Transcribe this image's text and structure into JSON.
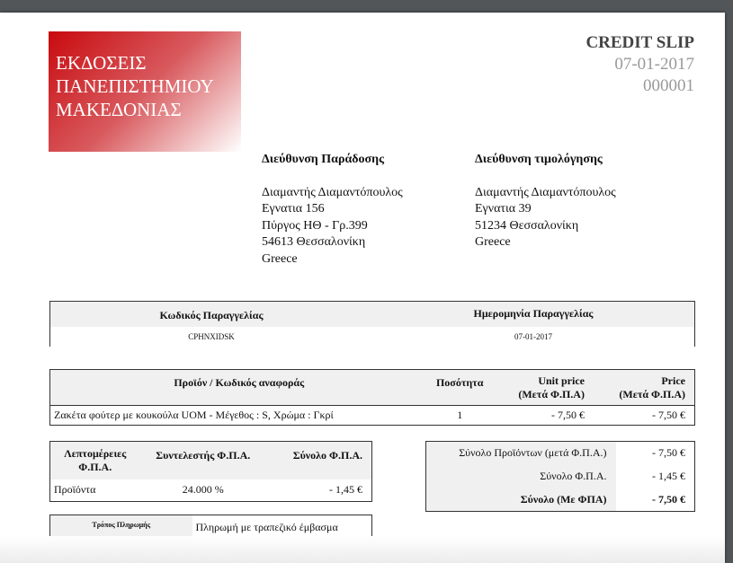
{
  "logo": {
    "lines": [
      "ΕΚΔΟΣΕΙΣ",
      "ΠΑΝΕΠΙΣΤΗΜΙΟΥ",
      "ΜΑΚΕΔΟΝΙΑΣ"
    ]
  },
  "header": {
    "title": "CREDIT SLIP",
    "date": "07-01-2017",
    "number": "000001"
  },
  "delivery": {
    "heading": "Διεύθυνση Παράδοσης",
    "lines": [
      "Διαμαντής Διαμαντόπουλος",
      "Εγνατια 156",
      "Πύργος ΗΘ - Γρ.399",
      "54613 Θεσσαλονίκη",
      "Greece"
    ]
  },
  "invoice": {
    "heading": "Διεύθυνση τιμολόγησης",
    "lines": [
      "Διαμαντής Διαμαντόπουλος",
      "Εγνατια 39",
      "51234 Θεσσαλονίκη",
      "Greece"
    ]
  },
  "order": {
    "headers": [
      "Κωδικός Παραγγελίας",
      "Ημερομηνία Παραγγελίας"
    ],
    "values": [
      "CPHNXIDSK",
      "07-01-2017"
    ]
  },
  "products": {
    "headers": [
      "Προϊόν / Κωδικός αναφοράς",
      "Ποσότητα",
      "Unit price",
      "(Μετά Φ.Π.Α)",
      "Price",
      "(Μετά Φ.Π.Α)"
    ],
    "rows": [
      {
        "name": "Ζακέτα φούτερ με κουκούλα UOM - Μέγεθος : S, Χρώμα : Γκρί",
        "qty": "1",
        "unit": "- 7,50 €",
        "price": "- 7,50 €"
      }
    ]
  },
  "vat": {
    "headers": [
      "Λεπτομέρειες Φ.Π.Α.",
      "Συντελεστής Φ.Π.Α.",
      "Σύνολο Φ.Π.Α."
    ],
    "row": [
      "Προϊόντα",
      "24.000 %",
      "- 1,45 €"
    ]
  },
  "payment": {
    "label": "Τρόπος Πληρωμής",
    "value": "Πληρωμή με τραπεζικό έμβασμα"
  },
  "totals": [
    {
      "label": "Σύνολο Προϊόντων (μετά Φ.Π.Α.)",
      "value": "- 7,50 €"
    },
    {
      "label": "Σύνολο Φ.Π.Α.",
      "value": "- 1,45 €"
    },
    {
      "label": "Σύνολο (Με ΦΠΑ)",
      "value": "- 7,50 €"
    }
  ]
}
